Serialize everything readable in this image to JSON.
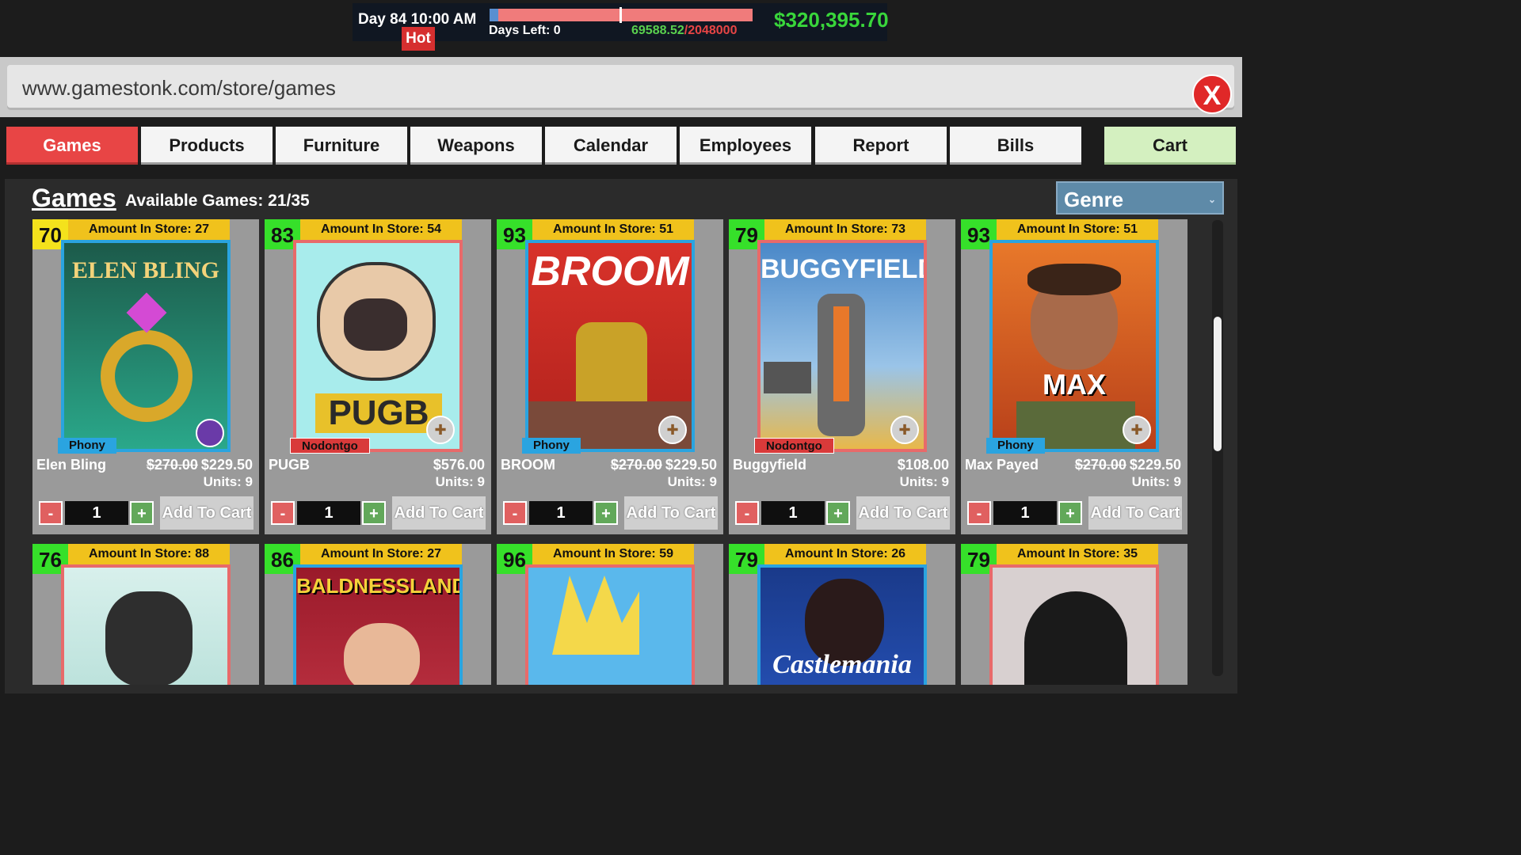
{
  "hud": {
    "day": "Day 84",
    "time": "10:00 AM",
    "hot": "Hot",
    "days_left": "Days Left: 0",
    "progress_current": "69588.52",
    "progress_sep": "/",
    "progress_max": "2048000",
    "money": "$320,395.70"
  },
  "browser": {
    "url": "www.gamestonk.com/store/games",
    "close_label": "X"
  },
  "tabs": [
    {
      "label": "Games"
    },
    {
      "label": "Products"
    },
    {
      "label": "Furniture"
    },
    {
      "label": "Weapons"
    },
    {
      "label": "Calendar"
    },
    {
      "label": "Employees"
    },
    {
      "label": "Report"
    },
    {
      "label": "Bills"
    },
    {
      "label": "Cart"
    }
  ],
  "content": {
    "title": "Games",
    "available": "Available Games: 21/35",
    "genre_label": "Genre"
  },
  "cards": [
    {
      "score": "70",
      "amount": "Amount In Store: 27",
      "cover_title": "ELEN BLING",
      "publisher": "Phony",
      "name": "Elen Bling",
      "old_price": "$270.00",
      "price": "$229.50",
      "units": "Units: 9",
      "qty": "1",
      "minus": "-",
      "plus": "+",
      "add": "Add To Cart"
    },
    {
      "score": "83",
      "amount": "Amount In Store: 54",
      "cover_title": "PUGB",
      "publisher": "Nodontgo",
      "name": "PUGB",
      "old_price": "",
      "price": "$576.00",
      "units": "Units: 9",
      "qty": "1",
      "minus": "-",
      "plus": "+",
      "add": "Add To Cart"
    },
    {
      "score": "93",
      "amount": "Amount In Store: 51",
      "cover_title": "BROOM",
      "publisher": "Phony",
      "name": "BROOM",
      "old_price": "$270.00",
      "price": "$229.50",
      "units": "Units: 9",
      "qty": "1",
      "minus": "-",
      "plus": "+",
      "add": "Add To Cart"
    },
    {
      "score": "79",
      "amount": "Amount In Store: 73",
      "cover_title": "BUGGYFIELD",
      "publisher": "Nodontgo",
      "name": "Buggyfield",
      "old_price": "",
      "price": "$108.00",
      "units": "Units: 9",
      "qty": "1",
      "minus": "-",
      "plus": "+",
      "add": "Add To Cart"
    },
    {
      "score": "93",
      "amount": "Amount In Store: 51",
      "cover_title": "MAX PAYED",
      "publisher": "Phony",
      "name": "Max Payed",
      "old_price": "$270.00",
      "price": "$229.50",
      "units": "Units: 9",
      "qty": "1",
      "minus": "-",
      "plus": "+",
      "add": "Add To Cart"
    },
    {
      "score": "76",
      "amount": "Amount In Store: 88",
      "cover_title": ""
    },
    {
      "score": "86",
      "amount": "Amount In Store: 27",
      "cover_title": "BALDNESSLANDS"
    },
    {
      "score": "96",
      "amount": "Amount In Store: 59",
      "cover_title": ""
    },
    {
      "score": "79",
      "amount": "Amount In Store: 26",
      "cover_title": "Castlemania"
    },
    {
      "score": "79",
      "amount": "Amount In Store: 35",
      "cover_title": ""
    }
  ],
  "colors": {
    "score_yellow": "#f4e21c",
    "score_green": "#36e02a",
    "accent_red": "#e84545",
    "money_green": "#39d63b"
  }
}
